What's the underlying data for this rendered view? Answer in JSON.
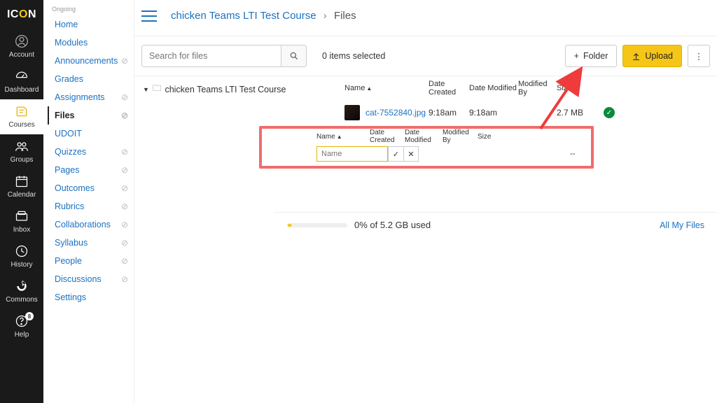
{
  "brand": {
    "pre": "IC",
    "mid": "O",
    "post": "N"
  },
  "global_nav": {
    "items": [
      {
        "label": "Account"
      },
      {
        "label": "Dashboard"
      },
      {
        "label": "Courses"
      },
      {
        "label": "Groups"
      },
      {
        "label": "Calendar"
      },
      {
        "label": "Inbox"
      },
      {
        "label": "History"
      },
      {
        "label": "Commons"
      },
      {
        "label": "Help"
      }
    ],
    "help_badge": "8"
  },
  "course_nav": {
    "header": "Ongoing",
    "items": [
      {
        "label": "Home",
        "hidden": false
      },
      {
        "label": "Modules",
        "hidden": false
      },
      {
        "label": "Announcements",
        "hidden": true
      },
      {
        "label": "Grades",
        "hidden": false
      },
      {
        "label": "Assignments",
        "hidden": true
      },
      {
        "label": "Files",
        "hidden": true,
        "active": true
      },
      {
        "label": "UDOIT",
        "hidden": false
      },
      {
        "label": "Quizzes",
        "hidden": true
      },
      {
        "label": "Pages",
        "hidden": true
      },
      {
        "label": "Outcomes",
        "hidden": true
      },
      {
        "label": "Rubrics",
        "hidden": true
      },
      {
        "label": "Collaborations",
        "hidden": true
      },
      {
        "label": "Syllabus",
        "hidden": true
      },
      {
        "label": "People",
        "hidden": true
      },
      {
        "label": "Discussions",
        "hidden": true
      },
      {
        "label": "Settings",
        "hidden": false
      }
    ]
  },
  "breadcrumb": {
    "course": "chicken Teams LTI Test Course",
    "separator": "›",
    "leaf": "Files"
  },
  "toolbar": {
    "search_placeholder": "Search for files",
    "selected": "0 items selected",
    "folder_btn": "Folder",
    "upload_btn": "Upload"
  },
  "tree": {
    "root": "chicken Teams LTI Test Course"
  },
  "columns": {
    "name": "Name",
    "date_created": "Date Created",
    "date_modified": "Date Modified",
    "modified_by": "Modified By",
    "size": "Size"
  },
  "file_row": {
    "name": "cat-7552840.jpg",
    "date_created": "9:18am",
    "date_modified": "9:18am",
    "modified_by": "",
    "size": "2.7 MB"
  },
  "callout": {
    "name_placeholder": "Name",
    "size": "--"
  },
  "footer": {
    "quota": "0% of 5.2 GB used",
    "all_files": "All My Files"
  }
}
